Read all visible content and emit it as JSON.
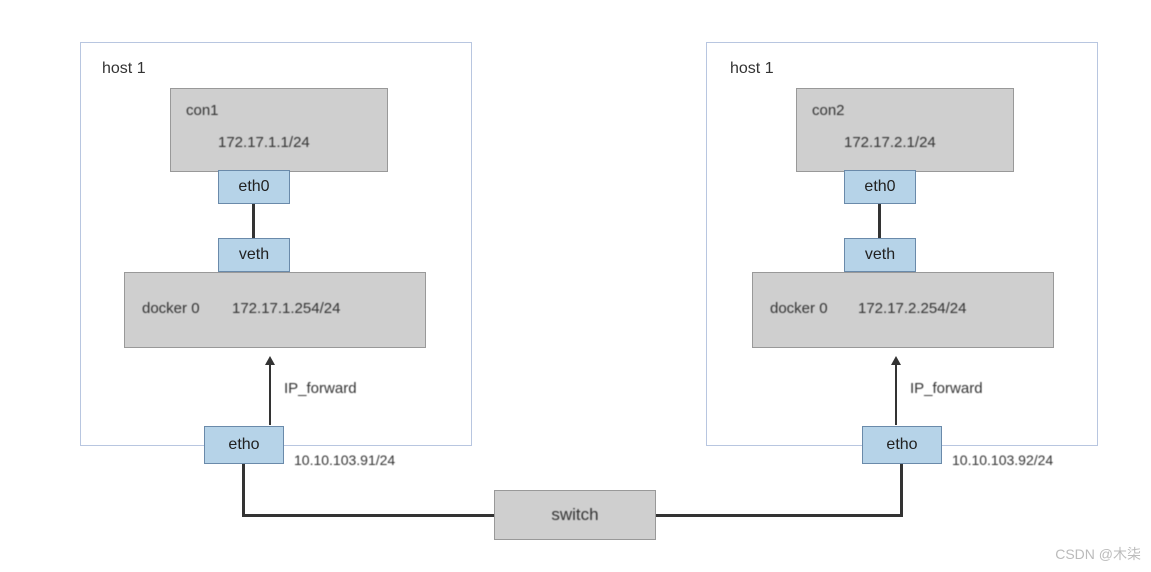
{
  "hosts": [
    {
      "label": "host 1",
      "container": {
        "name": "con1",
        "ip": "172.17.1.1/24",
        "iface": "eth0"
      },
      "veth": "veth",
      "bridge": {
        "name": "docker 0",
        "ip": "172.17.1.254/24"
      },
      "forward_label": "IP_forward",
      "host_iface": "etho",
      "host_ip": "10.10.103.91/24"
    },
    {
      "label": "host 1",
      "container": {
        "name": "con2",
        "ip": "172.17.2.1/24",
        "iface": "eth0"
      },
      "veth": "veth",
      "bridge": {
        "name": "docker 0",
        "ip": "172.17.2.254/24"
      },
      "forward_label": "IP_forward",
      "host_iface": "etho",
      "host_ip": "10.10.103.92/24"
    }
  ],
  "switch_label": "switch",
  "watermark": "CSDN @木柒"
}
